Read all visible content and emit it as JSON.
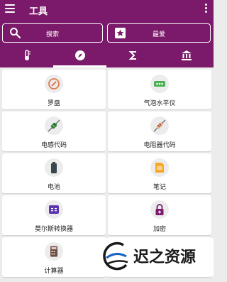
{
  "app": {
    "title": "工具",
    "accent_color": "#7b1a6a"
  },
  "toolbar": {
    "menu_icon": "hamburger-menu-icon",
    "more_icon": "more-vert-icon",
    "search_label": "搜索",
    "favorites_label": "最爱"
  },
  "tabs": [
    {
      "icon": "thermometer-icon",
      "selected": false
    },
    {
      "icon": "compass-icon",
      "selected": true
    },
    {
      "icon": "sigma-icon",
      "selected": false
    },
    {
      "icon": "bank-icon",
      "selected": false
    }
  ],
  "tools": [
    {
      "label": "罗盘",
      "icon": "compass-icon",
      "color": "#e07a4f"
    },
    {
      "label": "气泡水平仪",
      "icon": "bubble-level-icon",
      "color": "#4caf50"
    },
    {
      "label": "电感代码",
      "icon": "inductor-icon",
      "color": "#2e7d32"
    },
    {
      "label": "电阻器代码",
      "icon": "resistor-icon",
      "color": "#c62828"
    },
    {
      "label": "电池",
      "icon": "battery-icon",
      "color": "#37474f"
    },
    {
      "label": "笔记",
      "icon": "note-icon",
      "color": "#f9a825"
    },
    {
      "label": "莫尔斯转换器",
      "icon": "morse-converter-icon",
      "color": "#5e35b1"
    },
    {
      "label": "加密",
      "icon": "lock-icon",
      "color": "#7b1a6a"
    },
    {
      "label": "计算器",
      "icon": "calculator-icon",
      "color": "#6d4c41"
    }
  ],
  "watermark": {
    "text_1": "迟",
    "separator": "之",
    "text_2": "资源"
  }
}
